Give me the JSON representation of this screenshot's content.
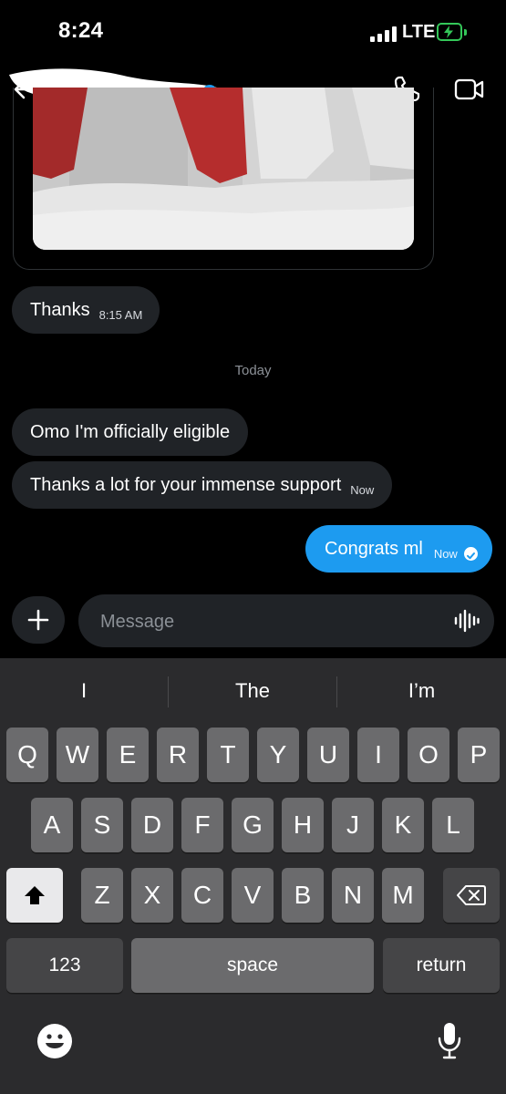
{
  "status_bar": {
    "time": "8:24",
    "network": "LTE"
  },
  "header": {
    "back_icon": "arrow-left-icon",
    "call_icon": "phone-icon",
    "video_icon": "video-icon"
  },
  "messages": [
    {
      "direction": "incoming",
      "text": "Thanks",
      "time": "8:15 AM"
    },
    {
      "direction": "divider",
      "text": "Today"
    },
    {
      "direction": "incoming",
      "text": "Omo I'm officially eligible",
      "time": ""
    },
    {
      "direction": "incoming",
      "text": "Thanks a lot for your immense support",
      "time": "Now"
    },
    {
      "direction": "outgoing",
      "text": "Congrats ml",
      "time": "Now"
    }
  ],
  "composer": {
    "placeholder": "Message"
  },
  "keyboard": {
    "suggestions": [
      "I",
      "The",
      "I’m"
    ],
    "row1": [
      "Q",
      "W",
      "E",
      "R",
      "T",
      "Y",
      "U",
      "I",
      "O",
      "P"
    ],
    "row2": [
      "A",
      "S",
      "D",
      "F",
      "G",
      "H",
      "J",
      "K",
      "L"
    ],
    "row3": [
      "Z",
      "X",
      "C",
      "V",
      "B",
      "N",
      "M"
    ],
    "numbers_label": "123",
    "space_label": "space",
    "return_label": "return"
  },
  "colors": {
    "accent": "#1d9bf0",
    "bubble": "#202327",
    "battery": "#34c759"
  }
}
